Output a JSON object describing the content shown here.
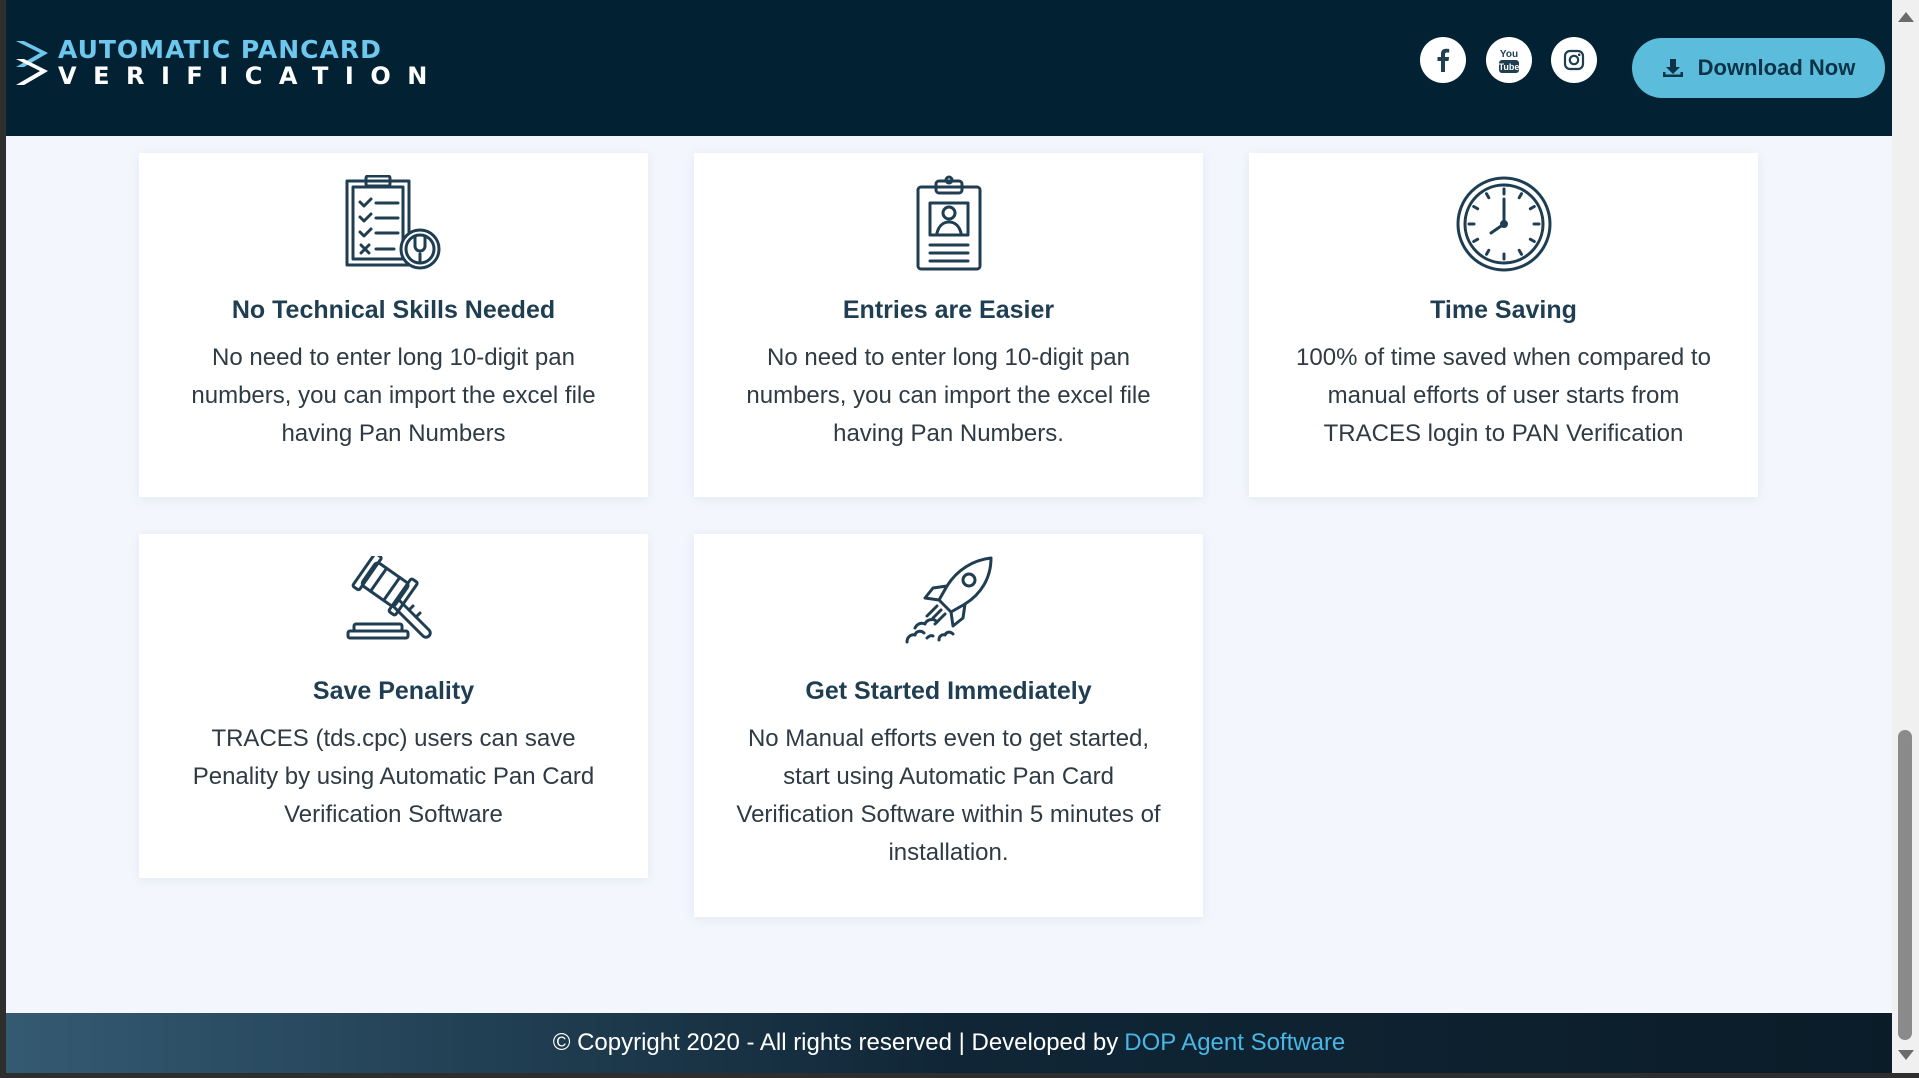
{
  "header": {
    "logo_line1": "AUTOMATIC PANCARD",
    "logo_line2": "VERIFICATION",
    "social": [
      {
        "name": "facebook",
        "icon": "facebook-icon"
      },
      {
        "name": "youtube",
        "icon": "youtube-icon",
        "label_top": "You",
        "label_bottom": "Tube"
      },
      {
        "name": "instagram",
        "icon": "instagram-icon"
      }
    ],
    "download_label": "Download Now",
    "download_icon": "download-icon"
  },
  "features": [
    {
      "icon": "checklist-wrench-icon",
      "title": "No Technical Skills Needed",
      "text": "No need to enter long 10-digit pan numbers, you can import the excel file having Pan Numbers"
    },
    {
      "icon": "id-clipboard-icon",
      "title": "Entries are Easier",
      "text": "No need to enter long 10-digit pan numbers, you can import the excel file having Pan Numbers."
    },
    {
      "icon": "clock-icon",
      "title": "Time Saving",
      "text": "100% of time saved when compared to manual efforts of user starts from TRACES login to PAN Verification"
    },
    {
      "icon": "gavel-icon",
      "title": "Save Penality",
      "text": "TRACES (tds.cpc) users can save Penality by using Automatic Pan Card Verification Software"
    },
    {
      "icon": "rocket-icon",
      "title": "Get Started Immediately",
      "text": "No Manual efforts even to get started, start using Automatic Pan Card Verification Software within 5 minutes of installation."
    }
  ],
  "footer": {
    "text": "© Copyright 2020 - All rights reserved | Developed by",
    "link": "DOP Agent Software"
  },
  "colors": {
    "header_bg": "#022233",
    "accent": "#5bbcdc",
    "logo_accent": "#6ec7ec",
    "icon_stroke": "#1f3e52",
    "page_bg": "#f3f7fd",
    "footer_link": "#49b6e6"
  }
}
